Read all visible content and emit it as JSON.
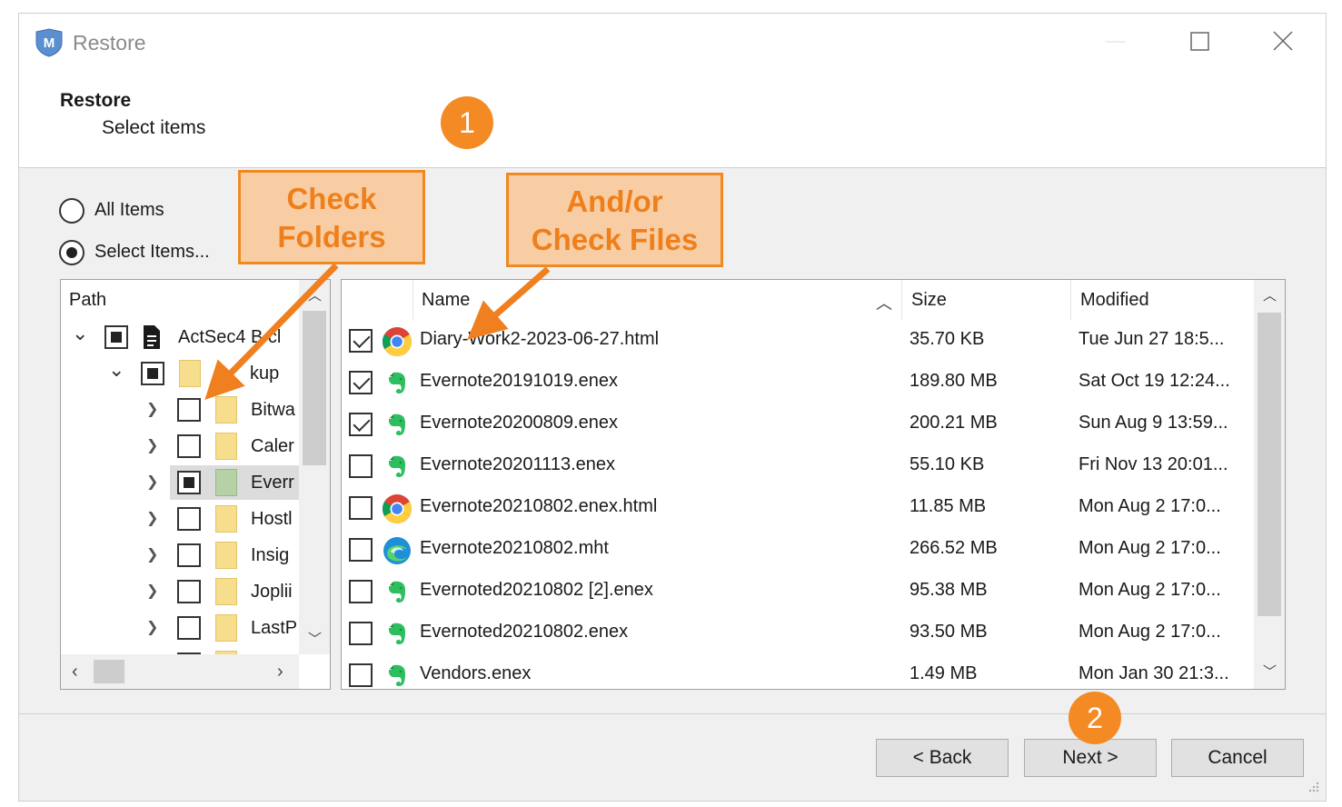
{
  "window": {
    "title": "Restore",
    "controls": [
      "minimize",
      "maximize",
      "close"
    ]
  },
  "header": {
    "title": "Restore",
    "subtitle": "Select items"
  },
  "options": [
    {
      "label": "All Items",
      "selected": false
    },
    {
      "label": "Select Items...",
      "selected": true
    }
  ],
  "tree": {
    "header": "Path",
    "rows": [
      {
        "label": "ActSec4 B cl",
        "state": "partial",
        "expanded": true,
        "icon": "document-icon"
      },
      {
        "label": "kup",
        "state": "partial",
        "expanded": true,
        "icon": "folder-icon"
      },
      {
        "label": "Bitwa",
        "state": "unchecked",
        "icon": "folder-icon"
      },
      {
        "label": "Caler",
        "state": "unchecked",
        "icon": "folder-icon"
      },
      {
        "label": "Everr",
        "state": "partial",
        "icon": "folder-icon",
        "selected": true
      },
      {
        "label": "Hostl",
        "state": "unchecked",
        "icon": "folder-icon"
      },
      {
        "label": "Insig",
        "state": "unchecked",
        "icon": "folder-icon"
      },
      {
        "label": "Joplii",
        "state": "unchecked",
        "icon": "folder-icon"
      },
      {
        "label": "LastP",
        "state": "unchecked",
        "icon": "folder-icon"
      }
    ]
  },
  "files": {
    "columns": {
      "name": "Name",
      "size": "Size",
      "modified": "Modified"
    },
    "rows": [
      {
        "name": "Diary-Work2-2023-06-27.html",
        "size": "35.70 KB",
        "modified": "Tue Jun 27 18:5...",
        "checked": true,
        "icon": "chrome-icon"
      },
      {
        "name": "Evernote20191019.enex",
        "size": "189.80 MB",
        "modified": "Sat Oct 19 12:24...",
        "checked": true,
        "icon": "evernote-icon"
      },
      {
        "name": "Evernote20200809.enex",
        "size": "200.21 MB",
        "modified": "Sun Aug 9 13:59...",
        "checked": true,
        "icon": "evernote-icon"
      },
      {
        "name": "Evernote20201113.enex",
        "size": "55.10 KB",
        "modified": "Fri Nov 13 20:01...",
        "checked": false,
        "icon": "evernote-icon"
      },
      {
        "name": "Evernote20210802.enex.html",
        "size": "11.85 MB",
        "modified": "Mon Aug 2 17:0...",
        "checked": false,
        "icon": "chrome-icon"
      },
      {
        "name": "Evernote20210802.mht",
        "size": "266.52 MB",
        "modified": "Mon Aug 2 17:0...",
        "checked": false,
        "icon": "edge-icon"
      },
      {
        "name": "Evernoted20210802 [2].enex",
        "size": "95.38 MB",
        "modified": "Mon Aug 2 17:0...",
        "checked": false,
        "icon": "evernote-icon"
      },
      {
        "name": "Evernoted20210802.enex",
        "size": "93.50 MB",
        "modified": "Mon Aug 2 17:0...",
        "checked": false,
        "icon": "evernote-icon"
      },
      {
        "name": "Vendors.enex",
        "size": "1.49 MB",
        "modified": "Mon Jan 30 21:3...",
        "checked": false,
        "icon": "evernote-icon"
      }
    ]
  },
  "buttons": {
    "back": "< Back",
    "next": "Next >",
    "cancel": "Cancel"
  },
  "annotations": {
    "callout_folders": [
      "Check",
      "Folders"
    ],
    "callout_files": [
      "And/or",
      "Check Files"
    ],
    "badge_1": "1",
    "badge_2": "2"
  },
  "colors": {
    "accent_orange": "#f48a23",
    "callout_fill": "#f8cda4",
    "evernote_green": "#2dbe60"
  }
}
